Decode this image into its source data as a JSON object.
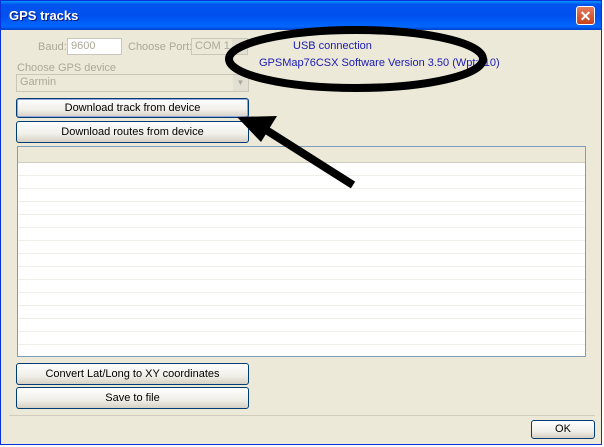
{
  "window": {
    "title": "GPS tracks",
    "close_glyph": "✕"
  },
  "settings": {
    "baud_label": "Baud:",
    "baud_value": "9600",
    "port_label": "Choose Port:",
    "port_value": "COM 1",
    "device_label": "Choose GPS device",
    "device_value": "Garmin",
    "connection_status": "USB connection",
    "device_info": "GPSMap76CSX Software Version 3.50 (Wpt:110)"
  },
  "actions": {
    "download_track": "Download track from device",
    "download_routes": "Download routes from device",
    "convert": "Convert Lat/Long to XY coordinates",
    "save": "Save to file",
    "ok": "OK"
  },
  "icons": {
    "dropdown": "chevron-down-icon",
    "close": "close-icon"
  },
  "colors": {
    "titlebar": "#0053ee",
    "annotation": "#000000",
    "status_text": "#1a1ab4"
  }
}
